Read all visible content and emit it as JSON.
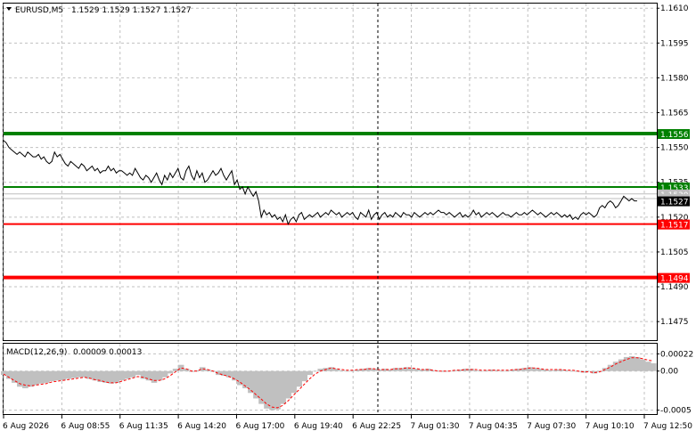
{
  "header": {
    "symbol_label": "EURUSD,M5",
    "ohlc": "1.1529 1.1529 1.1527 1.1527"
  },
  "macd_header": {
    "label": "MACD(12,26,9)",
    "values": "0.00009 0.00013"
  },
  "colors": {
    "price_line": "#000000",
    "resistance_strong": "#008000",
    "resistance": "#008000",
    "support": "#ff0000",
    "support_strong": "#ff0000",
    "current_price_badge": "#000000",
    "faint_line": "#bdbdbd",
    "macd_histogram": "#c0c0c0",
    "macd_signal": "#ff0000"
  },
  "chart_data": [
    {
      "type": "line",
      "name": "price",
      "ylim": [
        1.1467,
        1.1612
      ],
      "y_ticks": [
        1.161,
        1.1595,
        1.158,
        1.1565,
        1.155,
        1.1535,
        1.152,
        1.1505,
        1.149,
        1.1475
      ],
      "y_tick_labels": [
        "1.1610",
        "1.1595",
        "1.1580",
        "1.1565",
        "1.1550",
        "1.1535",
        "1.1520",
        "1.1505",
        "1.1490",
        "1.1475"
      ],
      "x_labels": [
        "6 Aug 2026",
        "6 Aug 08:55",
        "6 Aug 11:35",
        "6 Aug 14:20",
        "6 Aug 17:00",
        "6 Aug 19:40",
        "6 Aug 22:25",
        "7 Aug 01:30",
        "7 Aug 04:35",
        "7 Aug 07:30",
        "7 Aug 10:10",
        "7 Aug 12:50"
      ],
      "x": [
        0,
        3,
        6,
        9,
        12,
        15,
        18,
        21,
        24,
        27,
        30,
        33,
        36,
        39,
        42,
        45,
        48,
        51,
        54,
        57,
        60,
        63,
        66,
        69,
        72,
        75,
        78,
        81,
        84,
        87,
        90,
        93,
        96,
        99,
        102,
        105,
        108,
        111,
        114,
        117,
        120,
        123,
        126,
        129,
        132,
        135,
        138,
        141,
        144,
        147,
        150,
        153,
        156,
        159,
        162,
        165,
        168,
        171,
        174,
        177,
        180,
        183,
        186,
        189,
        192,
        195,
        198,
        201,
        204,
        207,
        210,
        213,
        216,
        219,
        222,
        225,
        228,
        231,
        234,
        237,
        240,
        243,
        246,
        249,
        252,
        255,
        258,
        261,
        264,
        267,
        270,
        273,
        276,
        279,
        282,
        285,
        288,
        291,
        294,
        297,
        300,
        303,
        306,
        309,
        312,
        315,
        318,
        321,
        324,
        327,
        330,
        333,
        336,
        339,
        342,
        345,
        348,
        351,
        354,
        357,
        360,
        363,
        366,
        369,
        372,
        375,
        378,
        381,
        384,
        387,
        390,
        393,
        396,
        399,
        402,
        405,
        408,
        411,
        414,
        417,
        420,
        423,
        426,
        429,
        432,
        435,
        438,
        441,
        444,
        447,
        450,
        453,
        456,
        459,
        462,
        465,
        468,
        471,
        474,
        477,
        480,
        483,
        486,
        489,
        492,
        495,
        498,
        501,
        504,
        507,
        510,
        513,
        516,
        519,
        522,
        525,
        528,
        531,
        534,
        537,
        540,
        543,
        546,
        549,
        552,
        555,
        558,
        561,
        564,
        567,
        570,
        573,
        576,
        579,
        582,
        585,
        588,
        591,
        594,
        597,
        600,
        603,
        606,
        609,
        612,
        615,
        618,
        621,
        624,
        627,
        630,
        633,
        636,
        639,
        642,
        645,
        648,
        651,
        654,
        657,
        660,
        663,
        666,
        669,
        672,
        675,
        678,
        681,
        684,
        687,
        690,
        693,
        696,
        699,
        702,
        705,
        708,
        711,
        714,
        717,
        720,
        723,
        726
      ],
      "values": [
        1.1553,
        1.1552,
        1.155,
        1.1549,
        1.1548,
        1.1547,
        1.1548,
        1.1547,
        1.1546,
        1.1548,
        1.1547,
        1.1546,
        1.1546,
        1.1547,
        1.1545,
        1.1546,
        1.1544,
        1.1543,
        1.1544,
        1.1548,
        1.1546,
        1.1547,
        1.1545,
        1.1543,
        1.1542,
        1.1544,
        1.1543,
        1.1542,
        1.1541,
        1.1543,
        1.1542,
        1.154,
        1.1541,
        1.1542,
        1.154,
        1.1541,
        1.1539,
        1.154,
        1.154,
        1.1542,
        1.154,
        1.1541,
        1.1539,
        1.154,
        1.154,
        1.1539,
        1.1538,
        1.1539,
        1.1538,
        1.1541,
        1.1539,
        1.1537,
        1.1536,
        1.1538,
        1.1537,
        1.1535,
        1.1537,
        1.1539,
        1.1536,
        1.1534,
        1.1538,
        1.1536,
        1.1539,
        1.1537,
        1.1539,
        1.1541,
        1.1537,
        1.1536,
        1.154,
        1.1542,
        1.1538,
        1.1536,
        1.154,
        1.1537,
        1.1539,
        1.1535,
        1.1536,
        1.1538,
        1.154,
        1.1538,
        1.1539,
        1.1541,
        1.1538,
        1.1536,
        1.1538,
        1.154,
        1.1534,
        1.1536,
        1.1532,
        1.1533,
        1.153,
        1.1533,
        1.1531,
        1.1529,
        1.1531,
        1.1527,
        1.152,
        1.1523,
        1.1521,
        1.1522,
        1.152,
        1.1521,
        1.1519,
        1.152,
        1.1518,
        1.1521,
        1.1517,
        1.1519,
        1.152,
        1.1518,
        1.1521,
        1.1522,
        1.1519,
        1.152,
        1.1521,
        1.152,
        1.1521,
        1.1522,
        1.152,
        1.1521,
        1.1522,
        1.1521,
        1.1523,
        1.1522,
        1.1521,
        1.1522,
        1.152,
        1.1521,
        1.1522,
        1.1521,
        1.1522,
        1.152,
        1.1519,
        1.1522,
        1.1521,
        1.152,
        1.1523,
        1.1519,
        1.1521,
        1.1522,
        1.1519,
        1.1521,
        1.1522,
        1.152,
        1.1521,
        1.152,
        1.1522,
        1.1521,
        1.152,
        1.1522,
        1.1521,
        1.1521,
        1.152,
        1.1522,
        1.1521,
        1.152,
        1.1521,
        1.1522,
        1.1521,
        1.1522,
        1.1521,
        1.1522,
        1.1523,
        1.1522,
        1.1522,
        1.1521,
        1.1522,
        1.1521,
        1.152,
        1.1521,
        1.1522,
        1.152,
        1.1521,
        1.152,
        1.1521,
        1.1523,
        1.1521,
        1.1522,
        1.152,
        1.1521,
        1.1522,
        1.1521,
        1.1522,
        1.1521,
        1.152,
        1.1521,
        1.1522,
        1.1521,
        1.1521,
        1.152,
        1.1521,
        1.1522,
        1.1521,
        1.1521,
        1.1522,
        1.1521,
        1.1522,
        1.1523,
        1.1522,
        1.1521,
        1.1522,
        1.1521,
        1.152,
        1.1521,
        1.1522,
        1.1521,
        1.1522,
        1.1521,
        1.152,
        1.1521,
        1.152,
        1.1521,
        1.1519,
        1.152,
        1.1519,
        1.1521,
        1.1522,
        1.1521,
        1.1522,
        1.1521,
        1.152,
        1.1521,
        1.1524,
        1.1525,
        1.1524,
        1.1526,
        1.1527,
        1.1526,
        1.1524,
        1.1525,
        1.1527,
        1.1529,
        1.1528,
        1.1527,
        1.1528,
        1.1527,
        1.1527
      ]
    },
    {
      "type": "hline",
      "name": "levels",
      "levels": [
        {
          "value": 1.1556,
          "label": "1.1556",
          "color": "#008000",
          "width": 4
        },
        {
          "value": 1.1533,
          "label": "1.1533",
          "color": "#008000",
          "width": 2
        },
        {
          "value": 1.153,
          "label": "1.1530",
          "color": "#bdbdbd",
          "width": 1
        },
        {
          "value": 1.1528,
          "label": "1.1528",
          "color": "#bdbdbd",
          "width": 1
        },
        {
          "value": 1.1517,
          "label": "1.1517",
          "color": "#ff0000",
          "width": 2
        },
        {
          "value": 1.1494,
          "label": "1.1494",
          "color": "#ff0000",
          "width": 4
        }
      ],
      "current_price": {
        "value": 1.1527,
        "label": "1.1527"
      }
    },
    {
      "type": "bar",
      "name": "macd",
      "ylim": [
        -0.00055,
        0.00035
      ],
      "y_ticks": [
        0.00022,
        0.0,
        -0.0005
      ],
      "y_tick_labels": [
        "0.00022",
        "0.00",
        "-0.0005"
      ],
      "x": [
        0,
        6,
        12,
        18,
        24,
        30,
        36,
        42,
        48,
        54,
        60,
        66,
        72,
        78,
        84,
        90,
        96,
        102,
        108,
        114,
        120,
        126,
        132,
        138,
        144,
        150,
        156,
        162,
        168,
        174,
        180,
        186,
        192,
        198,
        204,
        210,
        216,
        222,
        228,
        234,
        240,
        246,
        252,
        258,
        264,
        270,
        276,
        282,
        288,
        294,
        300,
        306,
        312,
        318,
        324,
        330,
        336,
        342,
        348,
        354,
        360,
        366,
        372,
        378,
        384,
        390,
        396,
        402,
        408,
        414,
        420,
        426,
        432,
        438,
        444,
        450,
        456,
        462,
        468,
        474,
        480,
        486,
        492,
        498,
        504,
        510,
        516,
        522,
        528,
        534,
        540,
        546,
        552,
        558,
        564,
        570,
        576,
        582,
        588,
        594,
        600,
        606,
        612,
        618,
        624,
        630,
        636,
        642,
        648,
        654,
        660,
        666,
        672,
        678,
        684,
        690,
        696,
        702,
        708,
        714,
        720,
        726
      ],
      "histogram": [
        -5e-05,
        -0.0001,
        -0.00015,
        -0.0002,
        -0.00022,
        -0.0002,
        -0.00018,
        -0.00016,
        -0.00015,
        -0.00013,
        -0.00012,
        -0.00012,
        -0.0001,
        -9e-05,
        -8e-05,
        -8e-05,
        -0.0001,
        -0.00012,
        -0.00014,
        -0.00015,
        -0.00016,
        -0.00015,
        -0.00012,
        -0.0001,
        -8e-05,
        -5e-05,
        -0.0001,
        -0.00012,
        -0.00015,
        -0.00012,
        -8e-05,
        -3e-05,
        3e-05,
        8e-05,
        3e-05,
        -1e-05,
        1e-05,
        5e-05,
        2e-05,
        -1e-05,
        -5e-05,
        -6e-05,
        -8e-05,
        -0.00012,
        -0.00018,
        -0.00022,
        -0.00028,
        -0.00035,
        -0.00042,
        -0.00048,
        -0.0005,
        -0.00049,
        -0.00042,
        -0.00035,
        -0.00028,
        -0.0002,
        -0.00013,
        -5e-05,
        0.0,
        3e-05,
        4e-05,
        5e-05,
        3e-05,
        1e-05,
        0.0,
        1e-05,
        2e-05,
        3e-05,
        4e-05,
        3e-05,
        2e-05,
        3e-05,
        2e-05,
        4e-05,
        4e-05,
        5e-05,
        4e-05,
        3e-05,
        2e-05,
        3e-05,
        1e-05,
        0.0,
        -1e-05,
        0.0,
        1e-05,
        2e-05,
        3e-05,
        3e-05,
        1e-05,
        0.0,
        1e-05,
        2e-05,
        1e-05,
        0.0,
        1e-05,
        2e-05,
        3e-05,
        4e-05,
        5e-05,
        4e-05,
        3e-05,
        2e-05,
        1e-05,
        2e-05,
        2e-05,
        1e-05,
        0.0,
        -1e-05,
        -2e-05,
        0.0,
        -3e-05,
        -1e-05,
        4e-05,
        8e-05,
        0.00012,
        0.00015,
        0.00018,
        0.00019,
        0.00018,
        0.00015,
        0.00012,
        0.0001
      ],
      "signal": [
        -4e-05,
        -8e-05,
        -0.00012,
        -0.00016,
        -0.00018,
        -0.00019,
        -0.00018,
        -0.00017,
        -0.00016,
        -0.00014,
        -0.00013,
        -0.00012,
        -0.00011,
        -0.0001,
        -9e-05,
        -8e-05,
        -9e-05,
        -0.00011,
        -0.00012,
        -0.00014,
        -0.00015,
        -0.00015,
        -0.00013,
        -0.00011,
        -9e-05,
        -7e-05,
        -8e-05,
        -0.0001,
        -0.00012,
        -0.00012,
        -0.0001,
        -6e-05,
        -1e-05,
        4e-05,
        3e-05,
        0.0,
        0.0,
        3e-05,
        2e-05,
        0.0,
        -3e-05,
        -5e-05,
        -7e-05,
        -0.0001,
        -0.00014,
        -0.00019,
        -0.00024,
        -0.0003,
        -0.00036,
        -0.00042,
        -0.00046,
        -0.00047,
        -0.00044,
        -0.00038,
        -0.00031,
        -0.00024,
        -0.00017,
        -0.0001,
        -4e-05,
        0.0,
        2e-05,
        4e-05,
        3e-05,
        2e-05,
        1e-05,
        1e-05,
        2e-05,
        2e-05,
        3e-05,
        3e-05,
        2e-05,
        2e-05,
        2e-05,
        3e-05,
        3e-05,
        4e-05,
        4e-05,
        3e-05,
        2e-05,
        2e-05,
        1e-05,
        0.0,
        0.0,
        0.0,
        1e-05,
        1e-05,
        2e-05,
        2e-05,
        2e-05,
        1e-05,
        1e-05,
        1e-05,
        1e-05,
        1e-05,
        1e-05,
        2e-05,
        2e-05,
        3e-05,
        4e-05,
        4e-05,
        3e-05,
        2e-05,
        2e-05,
        2e-05,
        2e-05,
        1e-05,
        1e-05,
        0.0,
        -1e-05,
        -1e-05,
        -2e-05,
        -1e-05,
        2e-05,
        5e-05,
        9e-05,
        0.00012,
        0.00015,
        0.00017,
        0.00017,
        0.00016,
        0.00014,
        0.00013
      ]
    }
  ]
}
